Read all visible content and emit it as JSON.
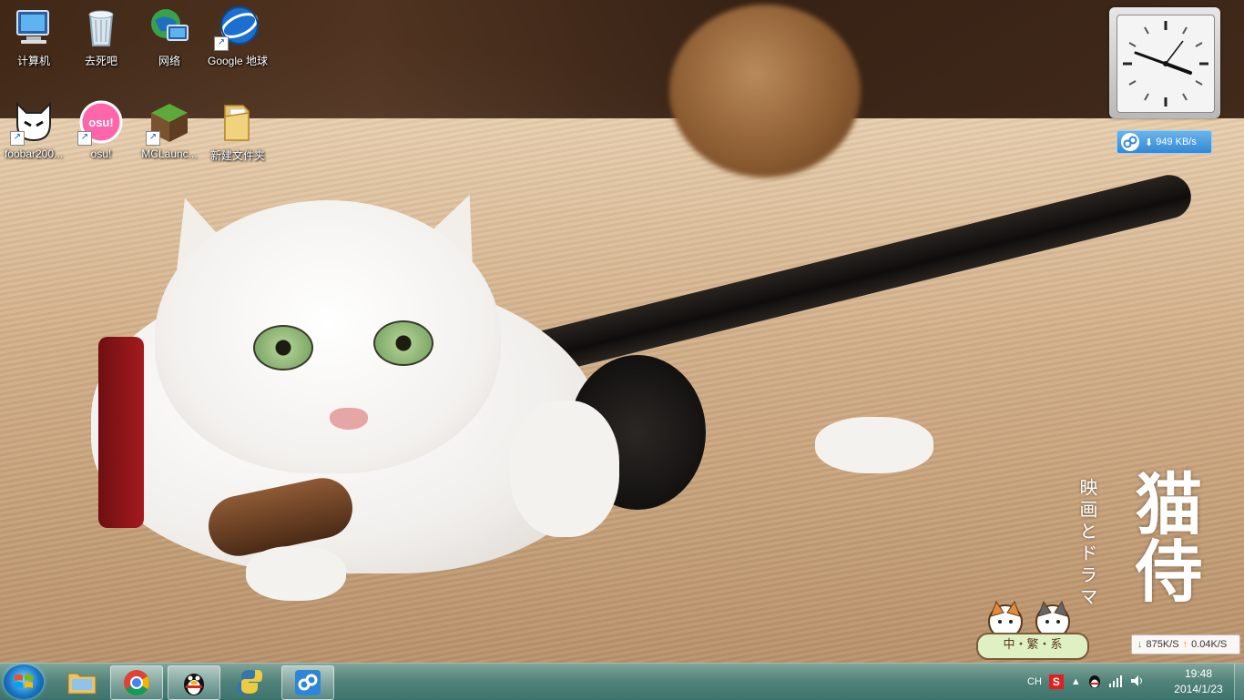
{
  "desktop": {
    "icons": [
      {
        "label": "计算机",
        "icon": "computer-icon",
        "shortcut": false
      },
      {
        "label": "去死吧",
        "icon": "recycle-bin-icon",
        "shortcut": false
      },
      {
        "label": "网络",
        "icon": "network-icon",
        "shortcut": false
      },
      {
        "label": "Google 地球",
        "icon": "google-earth-icon",
        "shortcut": true
      },
      {
        "label": "foobar200...",
        "icon": "foobar2000-icon",
        "shortcut": true
      },
      {
        "label": "osu!",
        "icon": "osu-icon",
        "shortcut": true
      },
      {
        "label": "MCLaunc...",
        "icon": "minecraft-launcher-icon",
        "shortcut": true
      },
      {
        "label": "新建文件夹",
        "icon": "folder-icon",
        "shortcut": false
      }
    ]
  },
  "gadgets": {
    "clock": {
      "icon": "analog-clock-icon",
      "time": "19:48"
    },
    "net_widget": {
      "speed": "949 KB/s"
    }
  },
  "wallpaper": {
    "title_small": "映画とドラマ",
    "title_big": "猫侍",
    "badge": "中・繁・系"
  },
  "netbar": {
    "down": "875K/S",
    "up": "0.04K/S"
  },
  "taskbar": {
    "pinned": [
      {
        "name": "explorer",
        "icon": "folder-icon",
        "active": false
      },
      {
        "name": "chrome",
        "icon": "chrome-icon",
        "active": true
      },
      {
        "name": "qq",
        "icon": "qq-penguin-icon",
        "active": true
      },
      {
        "name": "python",
        "icon": "python-icon",
        "active": false
      },
      {
        "name": "cloud",
        "icon": "cloud-sync-icon",
        "active": true
      }
    ],
    "tray": {
      "lang": "CH",
      "time": "19:48",
      "date": "2014/1/23"
    }
  },
  "colors": {
    "accent": "#3388d6",
    "taskbar": "#4f8a84"
  }
}
